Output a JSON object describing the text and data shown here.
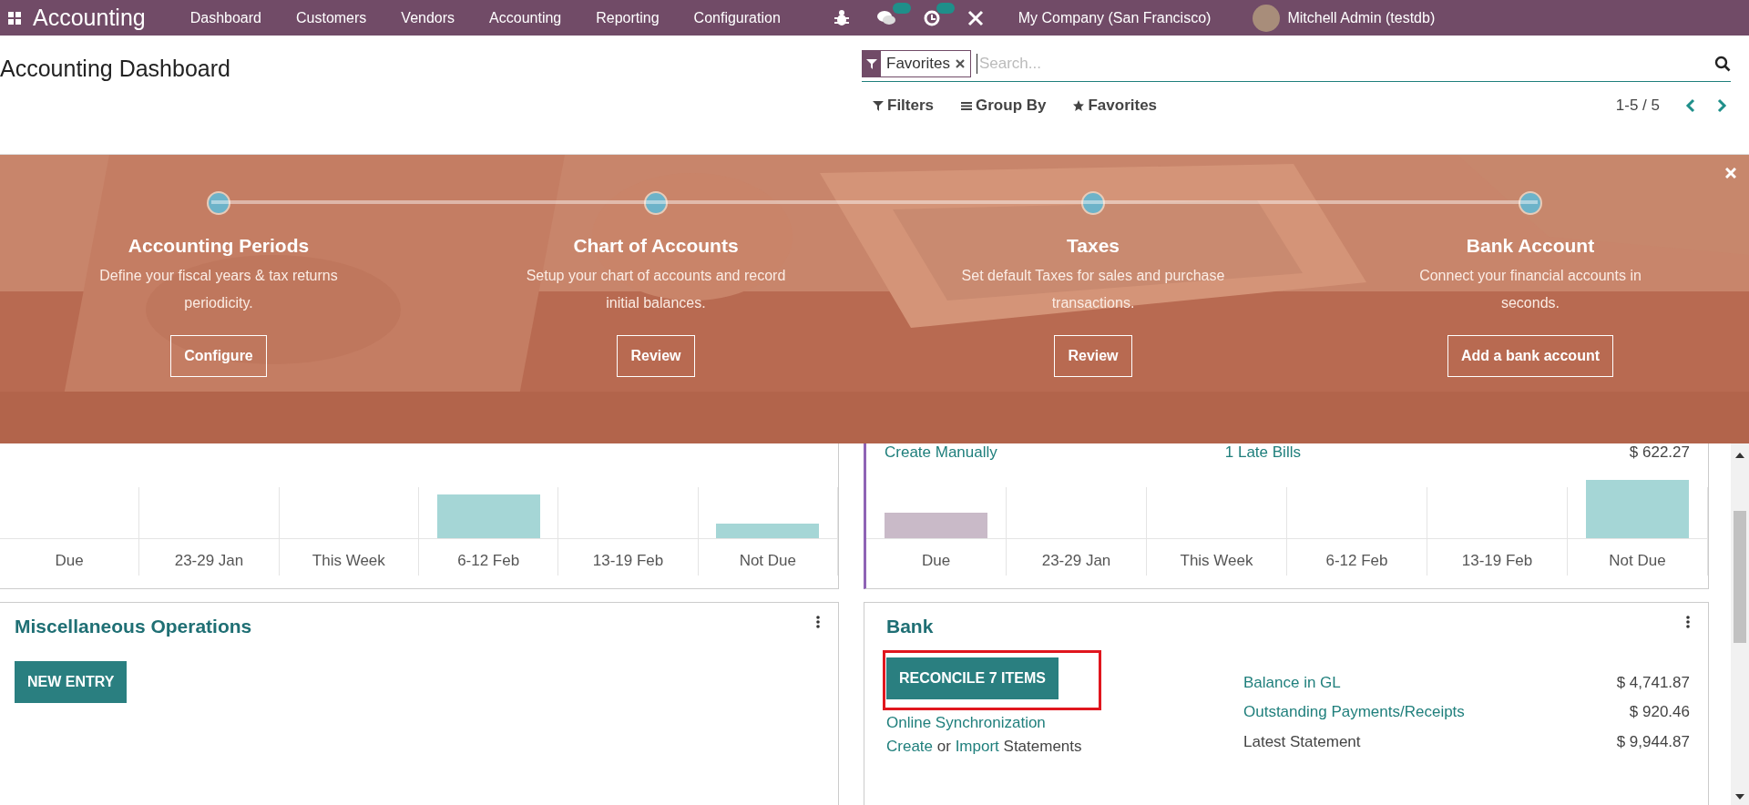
{
  "navbar": {
    "app_name": "Accounting",
    "menu": [
      "Dashboard",
      "Customers",
      "Vendors",
      "Accounting",
      "Reporting",
      "Configuration"
    ],
    "company": "My Company (San Francisco)",
    "user": "Mitchell Admin (testdb)"
  },
  "control_panel": {
    "title": "Accounting Dashboard",
    "facet": "Favorites",
    "search": {
      "placeholder": "Search..."
    },
    "filter_buttons": [
      {
        "kind": "filter",
        "label": "Filters"
      },
      {
        "kind": "group",
        "label": "Group By"
      },
      {
        "kind": "favorite",
        "label": "Favorites"
      }
    ],
    "pager": "1-5 / 5"
  },
  "onboarding": {
    "steps": [
      {
        "title": "Accounting Periods",
        "description": "Define your fiscal years & tax returns periodicity.",
        "button": "Configure"
      },
      {
        "title": "Chart of Accounts",
        "description": "Setup your chart of accounts and record initial balances.",
        "button": "Review"
      },
      {
        "title": "Taxes",
        "description": "Set default Taxes for sales and purchase transactions.",
        "button": "Review"
      },
      {
        "title": "Bank Account",
        "description": "Connect your financial accounts in seconds.",
        "button": "Add a bank account"
      }
    ]
  },
  "sales_card": {
    "categories": [
      "Due",
      "23-29 Jan",
      "This Week",
      "6-12 Feb",
      "13-19 Feb",
      "Not Due"
    ]
  },
  "purchase_card": {
    "action_link": "Create Manually",
    "late_bills": "1 Late Bills",
    "late_amount": "$ 622.27",
    "categories": [
      "Due",
      "23-29 Jan",
      "This Week",
      "6-12 Feb",
      "13-19 Feb",
      "Not Due"
    ]
  },
  "misc_card": {
    "title": "Miscellaneous Operations",
    "button": "NEW ENTRY"
  },
  "bank_card": {
    "title": "Bank",
    "button": "RECONCILE 7 ITEMS",
    "highlighted": true,
    "sync_link": "Online Synchronization",
    "statements_line": [
      {
        "kind": "link",
        "text": "Create"
      },
      {
        "kind": "text",
        "text": "or"
      },
      {
        "kind": "link",
        "text": "Import"
      },
      {
        "kind": "text",
        "text": "Statements"
      }
    ],
    "stats": [
      {
        "kind": "link",
        "label": "Balance in GL",
        "amount": "$ 4,741.87"
      },
      {
        "kind": "link",
        "label": "Outstanding Payments/Receipts",
        "amount": "$ 920.46"
      },
      {
        "kind": "text",
        "label": "Latest Statement",
        "amount": "$ 9,944.87"
      }
    ]
  }
}
